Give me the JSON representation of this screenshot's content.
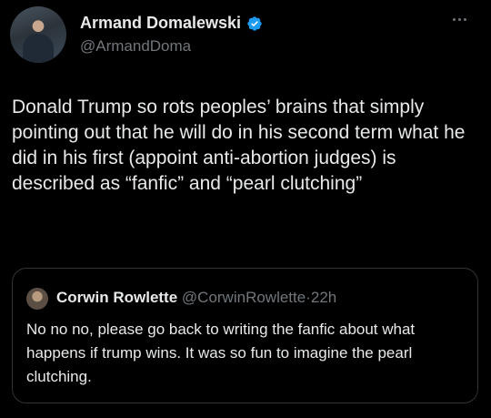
{
  "author": {
    "name": "Armand Domalewski",
    "handle": "@ArmandDoma"
  },
  "tweet": {
    "text": "Donald Trump so rots peoples’ brains that simply pointing out that he will do in his second term what he did in his first (appoint anti-abortion judges) is described as “fanfic” and “pearl clutching”"
  },
  "quoted": {
    "name": "Corwin Rowlette",
    "handle": "@CorwinRowlette",
    "separator": "·",
    "time": "22h",
    "text": "No no no, please go back to writing the fanfic about what happens if trump wins. It was so fun to imagine the pearl clutching."
  },
  "colors": {
    "background": "#000000",
    "text": "#e7e9ea",
    "muted": "#71767b",
    "verified": "#1d9bf0",
    "border": "#2f3336"
  },
  "icons": {
    "verified": "verified-badge-icon",
    "more": "more-horizontal-icon"
  }
}
